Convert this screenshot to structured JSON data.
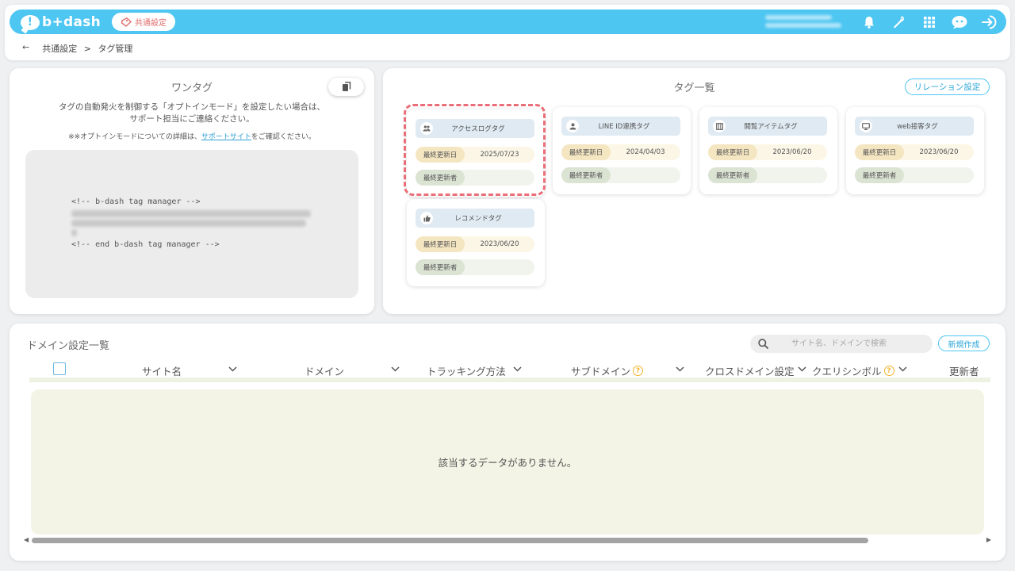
{
  "header": {
    "logo": "b+dash",
    "common_settings": "共通設定",
    "icons": [
      "bell-icon",
      "wrench-icon",
      "grid-icon",
      "chat-icon",
      "logout-icon"
    ]
  },
  "breadcrumb": {
    "back": "←",
    "items": [
      "共通設定",
      ">",
      "タグ管理"
    ]
  },
  "onetag": {
    "title": "ワンタグ",
    "desc_line1": "タグの自動発火を制御する「オプトインモード」を設定したい場合は、",
    "desc_line2": "サポート担当にご連絡ください。",
    "note_before": "※※オプトインモードについての詳細は、",
    "note_link": "サポートサイト",
    "note_after": "をご確認ください。",
    "code_start": "<!-- b-dash tag manager -->",
    "code_end": "<!-- end b-dash tag manager -->"
  },
  "taglist": {
    "title": "タグ一覧",
    "relation_button": "リレーション設定",
    "updated_label": "最終更新日",
    "updater_label": "最終更新者",
    "cards": [
      {
        "name": "アクセスログタグ",
        "icon": "users-icon",
        "date": "2025/07/23"
      },
      {
        "name": "LINE ID連携タグ",
        "icon": "person-icon",
        "date": "2024/04/03"
      },
      {
        "name": "閲覧アイテムタグ",
        "icon": "item-icon",
        "date": "2023/06/20"
      },
      {
        "name": "web接客タグ",
        "icon": "monitor-icon",
        "date": "2023/06/20"
      },
      {
        "name": "レコメンドタグ",
        "icon": "thumbs-up-icon",
        "date": "2023/06/20"
      }
    ]
  },
  "domain": {
    "title": "ドメイン設定一覧",
    "search_placeholder": "サイト名、ドメインで検索",
    "new_button": "新規作成",
    "columns": [
      "サイト名",
      "ドメイン",
      "トラッキング方法",
      "サブドメイン",
      "クロスドメイン設定",
      "クエリシンボル",
      "更新者"
    ],
    "empty_message": "該当するデータがありません。"
  },
  "colors": {
    "accent": "#4ec6f2",
    "highlight_dash": "#ea6e78",
    "help": "#f2b52e"
  }
}
